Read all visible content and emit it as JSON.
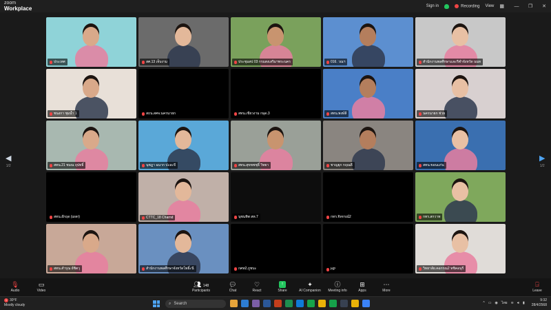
{
  "app": {
    "brand_small": "zoom",
    "brand_large": "Workplace"
  },
  "titlebar": {
    "sign_in": "Sign in",
    "recording": "Recording",
    "view": "View"
  },
  "tiles": [
    {
      "name": "ประเทศ",
      "bg": "#8fd3d8"
    },
    {
      "name": "สศ.13 เจ็บงาม",
      "bg": "#6b6b6b"
    },
    {
      "name": "ประชุมสป 03 กรมสงเสริมฯพระนคร",
      "bg": "#7aa15c"
    },
    {
      "name": "016. วณฯ",
      "bg": "#5c8fd0"
    },
    {
      "name": "สำนักงานพลศึกษาและกีฬาจังหวัด นนท",
      "bg": "#c8c8c8"
    },
    {
      "name": "ชนงกา ชุมน้ำ 1",
      "bg": "#e8e0d8"
    },
    {
      "name": "สถน.สศจ.นครนายก",
      "bg": "#000000"
    },
    {
      "name": "สทน.เขียวงาม กมุด.3",
      "bg": "#000000"
    },
    {
      "name": "สทน.พงษ์ลี",
      "bg": "#4a7fc7"
    },
    {
      "name": "นครนายก ช่วย",
      "bg": "#d8d0d0"
    },
    {
      "name": "สทน.21 ชมณ ฤปทธิ์",
      "bg": "#a8b8b0"
    },
    {
      "name": "นุชฎา ฉนาก ปะละจี",
      "bg": "#5aa8d8"
    },
    {
      "name": "สทน.สุขขชชุธิ์ วิทยา",
      "bg": "#9aa098"
    },
    {
      "name": "ชาญยุก กฤณดี",
      "bg": "#8a8580"
    },
    {
      "name": "สทน.ขอนแก่น",
      "bg": "#3a6fb0"
    },
    {
      "name": "สทน.อ๊กฤด (user)",
      "bg": "#000000"
    },
    {
      "name": "CTTC_18 Charnd",
      "bg": "#c0b0a8"
    },
    {
      "name": "นุชนทิพ สท.7",
      "bg": "#0d0d0d"
    },
    {
      "name": "กทร.จิทกรณ์2",
      "bg": "#000000"
    },
    {
      "name": "กทร.สกวาท",
      "bg": "#7fa85c"
    },
    {
      "name": "สทน.สำรุณ ย์ชิตวุ",
      "bg": "#c8a898"
    },
    {
      "name": "สำนักงานพลศึกษาจังหวัดโพธิ์ะนี",
      "bg": "#6a90c0"
    },
    {
      "name": "กศท2.ภูชบะ",
      "bg": "#000000"
    },
    {
      "name": "HP",
      "bg": "#000000"
    },
    {
      "name": "วิทยาลัย.คอกรณ2 ทชิคอนุรี",
      "bg": "#e0dcd8"
    }
  ],
  "pager": {
    "left": "1/2",
    "right": "1/2"
  },
  "toolbar": {
    "audio": "Audio",
    "video": "Video",
    "participants": "Participants",
    "participant_count": "148",
    "chat": "Chat",
    "react": "React",
    "share": "Share",
    "ai_companion": "AI Companion",
    "meeting_info": "Meeting info",
    "apps": "Apps",
    "more": "More",
    "leave": "Leave"
  },
  "taskbar": {
    "weather_temp": "30°F",
    "weather_desc": "Mostly cloudy",
    "search_placeholder": "Search",
    "lang": "ไทย",
    "time": "9:32",
    "date": "28/4/2568"
  }
}
